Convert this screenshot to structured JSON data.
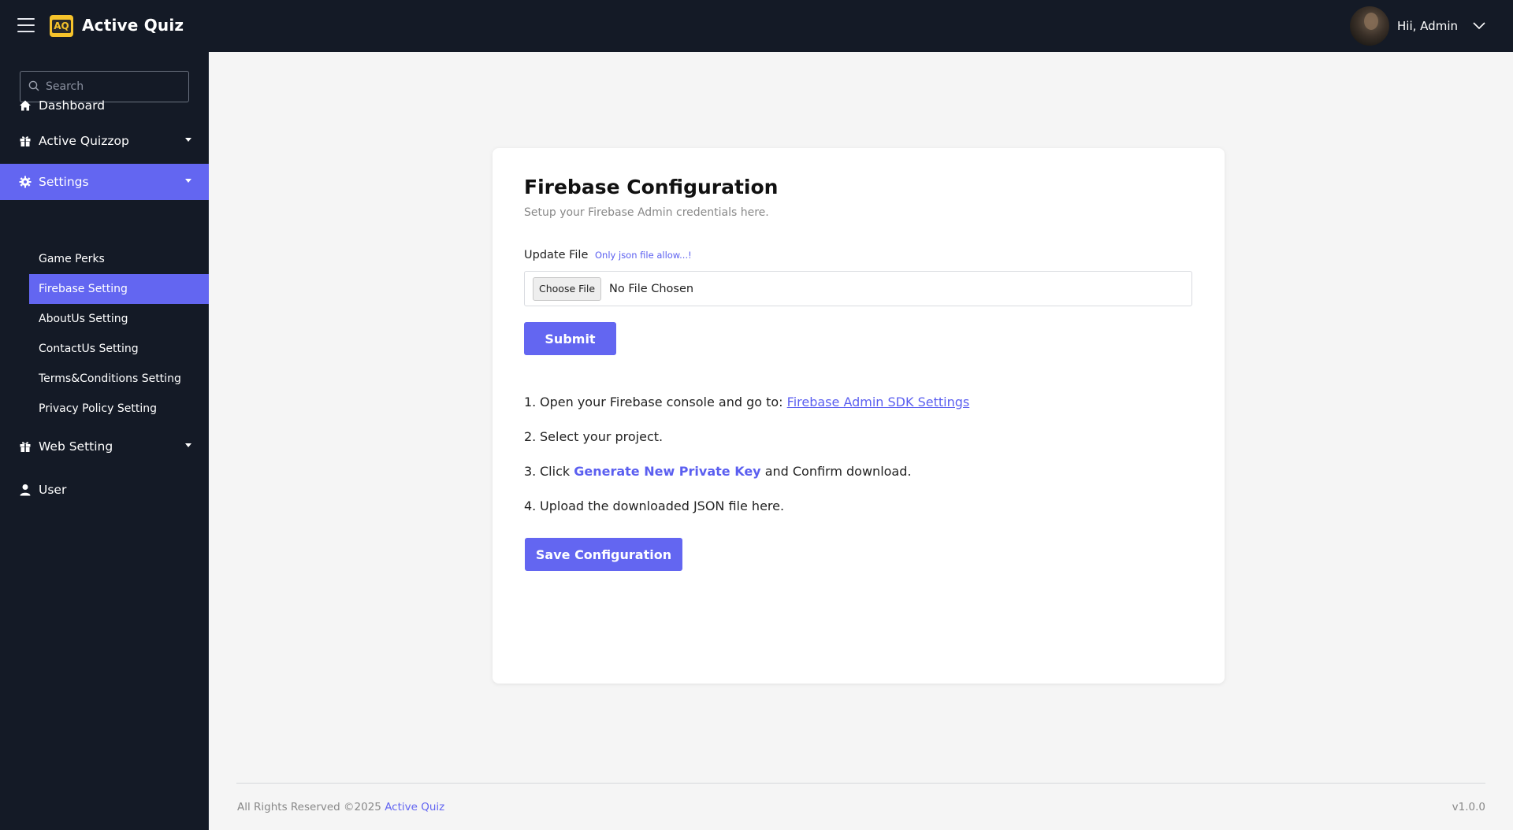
{
  "header": {
    "brand_logo_text": "AQ",
    "brand_name": "Active Quiz",
    "greeting": "Hii, Admin"
  },
  "sidebar": {
    "search_placeholder": "Search",
    "items": [
      {
        "label": "Dashboard",
        "icon": "home-icon"
      },
      {
        "label": "Active Quizzop",
        "icon": "gift-icon"
      },
      {
        "label": "Settings",
        "icon": "gear-icon"
      },
      {
        "label": "Web Setting",
        "icon": "gift-icon"
      },
      {
        "label": "User",
        "icon": "user-icon"
      }
    ],
    "settings_sub": [
      {
        "label": "Game Perks"
      },
      {
        "label": "Firebase Setting"
      },
      {
        "label": "AboutUs Setting"
      },
      {
        "label": "ContactUs Setting"
      },
      {
        "label": "Terms&Conditions Setting"
      },
      {
        "label": "Privacy Policy  Setting"
      }
    ]
  },
  "card": {
    "title": "Firebase Configuration",
    "subtitle": "Setup your Firebase Admin credentials here.",
    "file_label": "Update File",
    "file_hint": "Only json file allow...!",
    "choose_file_label": "Choose File",
    "no_file_text": "No File Chosen",
    "submit_label": "Submit",
    "steps": {
      "s1_num": "1.",
      "s1_text": "Open your Firebase console and go to:",
      "s1_link": "Firebase Admin SDK Settings",
      "s2_num": "2.",
      "s2_text": "Select your project.",
      "s3_num": "3.",
      "s3_pre": "Click",
      "s3_bold": "Generate New Private Key",
      "s3_post": "and Confirm download.",
      "s4_num": "4.",
      "s4_text": "Upload the downloaded JSON file here."
    },
    "save_label": "Save Configuration"
  },
  "footer": {
    "rights": "All Rights Reserved ©2025",
    "brand": "Active Quiz",
    "version": "v1.0.0"
  },
  "colors": {
    "accent": "#6366f1",
    "sidebar_bg": "#141a26",
    "page_bg": "#f5f5f5"
  }
}
